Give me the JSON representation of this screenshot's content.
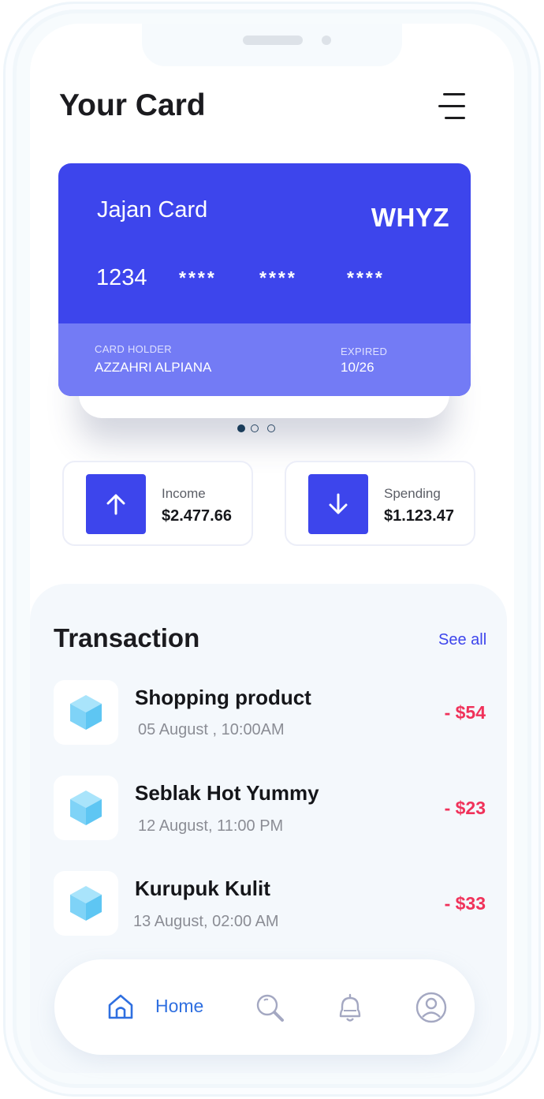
{
  "header": {
    "title": "Your Card",
    "menu_icon": "hamburger-menu-icon"
  },
  "card": {
    "name": "Jajan Card",
    "brand": "WHYZ",
    "number_first": "1234",
    "number_masked": [
      "****",
      "****",
      "****"
    ],
    "holder_label": "CARD HOLDER",
    "holder_name": "AZZAHRI ALPIANA",
    "expired_label": "EXPIRED",
    "expired_value": "10/26",
    "color": "#3d45ec",
    "color_light": "#737bf5"
  },
  "carousel": {
    "count": 3,
    "active_index": 0
  },
  "stats": {
    "income": {
      "label": "Income",
      "value": "$2.477.66",
      "icon": "arrow-up-icon"
    },
    "spending": {
      "label": "Spending",
      "value": "$1.123.47",
      "icon": "arrow-down-icon"
    }
  },
  "transactions": {
    "title": "Transaction",
    "see_all": "See all",
    "items": [
      {
        "name": "Shopping product",
        "date": "05 August , 10:00AM",
        "amount": "- $54",
        "icon": "cube-icon"
      },
      {
        "name": "Seblak Hot Yummy",
        "date": "12 August, 11:00 PM",
        "amount": "- $23",
        "icon": "cube-icon"
      },
      {
        "name": "Kurupuk Kulit",
        "date": "13 August, 02:00 AM",
        "amount": "- $33",
        "icon": "cube-icon"
      }
    ]
  },
  "nav": {
    "items": [
      {
        "label": "Home",
        "icon": "home-icon",
        "active": true
      },
      {
        "label": "",
        "icon": "search-icon",
        "active": false
      },
      {
        "label": "",
        "icon": "bell-icon",
        "active": false
      },
      {
        "label": "",
        "icon": "user-icon",
        "active": false
      }
    ]
  },
  "colors": {
    "accent": "#3d45ec",
    "negative": "#f0325a",
    "nav_active": "#2f6fe0"
  }
}
